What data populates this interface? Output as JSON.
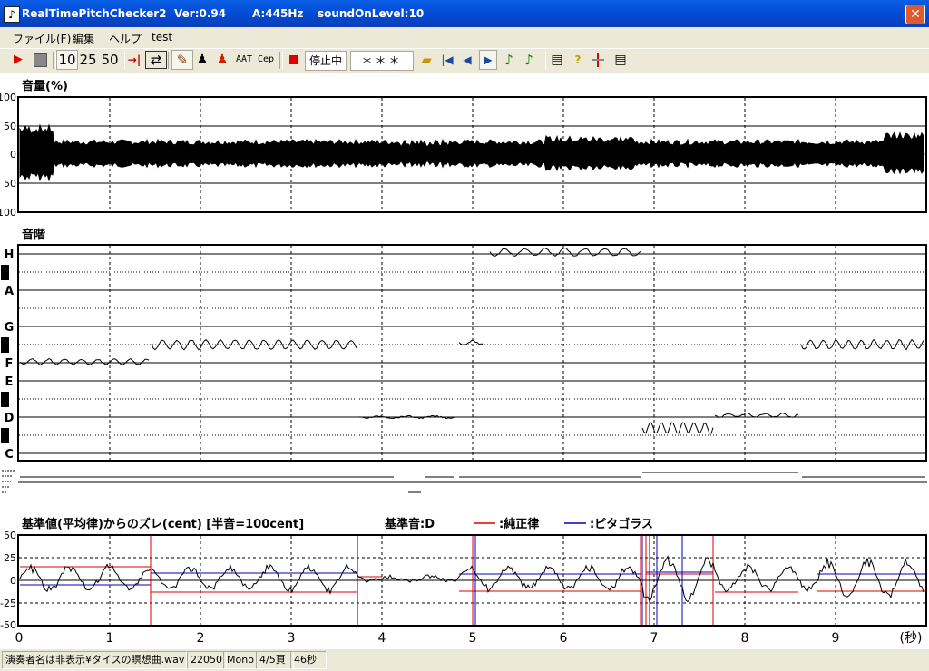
{
  "window": {
    "app_name": "RealTimePitchChecker2",
    "version": "Ver:0.94",
    "a_freq": "A:445Hz",
    "sound_on_level": "soundOnLevel:10",
    "close_glyph": "✕"
  },
  "menu": {
    "items": [
      "ファイル(F)",
      "編集",
      "ヘルプ",
      "test"
    ]
  },
  "toolbar": {
    "btn_10": "10",
    "btn_25": "25",
    "btn_50": "50",
    "btn_aat": "AAT",
    "btn_cep": "Cep",
    "status_text": "停止中",
    "display_text": "＊＊＊",
    "icons": [
      "play-icon",
      "stop-icon",
      "skip-end-icon",
      "loop-icon",
      "violin-icon",
      "person-icon",
      "person-red-icon",
      "record-icon",
      "folder-open-icon",
      "first-icon",
      "prev-icon",
      "next-icon",
      "note-icon",
      "note-alt-icon",
      "print-icon",
      "help-icon",
      "split-icon",
      "printer-icon"
    ]
  },
  "volume_panel": {
    "title": "音量(%)",
    "ticks": [
      "100",
      "50",
      "0",
      "50",
      "100"
    ]
  },
  "scale_panel": {
    "title": "音階",
    "notes": [
      "H",
      "A",
      "G",
      "F",
      "E",
      "D",
      "C"
    ]
  },
  "deviation_panel": {
    "title": "基準値(平均律)からのズレ(cent) [半音=100cent]",
    "reference": "基準音:D",
    "legend_just": ":純正律",
    "legend_pythagorean": ":ピタゴラス",
    "ticks": [
      "50",
      "25",
      "0",
      "-25",
      "-50"
    ],
    "just_color": "#e00000",
    "pythagorean_color": "#0000c0"
  },
  "time_axis": {
    "labels": [
      "0",
      "1",
      "2",
      "3",
      "4",
      "5",
      "6",
      "7",
      "8",
      "9"
    ],
    "unit": "(秒)"
  },
  "statusbar": {
    "file": "演奏者名は非表示¥タイスの瞑想曲.wav",
    "rate": "22050",
    "channels": "Mono",
    "page": "4/5頁",
    "duration": "46秒"
  }
}
